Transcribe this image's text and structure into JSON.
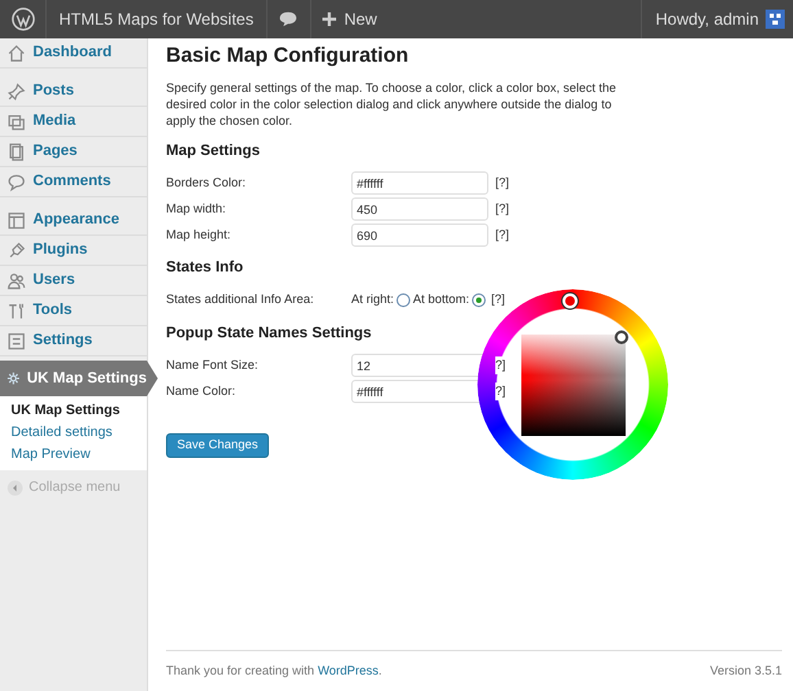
{
  "admin_bar": {
    "site_name": "HTML5 Maps for Websites",
    "new_label": "New",
    "greeting": "Howdy, admin"
  },
  "sidebar": {
    "items": [
      {
        "label": "Dashboard",
        "selected": false
      },
      {
        "label": "Posts",
        "selected": false
      },
      {
        "label": "Media",
        "selected": false
      },
      {
        "label": "Pages",
        "selected": false
      },
      {
        "label": "Comments",
        "selected": false
      },
      {
        "label": "Appearance",
        "selected": false
      },
      {
        "label": "Plugins",
        "selected": false
      },
      {
        "label": "Users",
        "selected": false
      },
      {
        "label": "Tools",
        "selected": false
      },
      {
        "label": "Settings",
        "selected": false
      },
      {
        "label": "UK Map Settings",
        "selected": true
      }
    ],
    "submenu": [
      {
        "label": "UK Map Settings",
        "selected": true
      },
      {
        "label": "Detailed settings",
        "selected": false
      },
      {
        "label": "Map Preview",
        "selected": false
      }
    ],
    "collapse_label": "Collapse menu"
  },
  "page": {
    "title": "Basic Map Configuration",
    "intro": "Specify general settings of the map. To choose a color, click a color box, select the desired color in the color selection dialog and click anywhere outside the dialog to apply the chosen color.",
    "sections": [
      {
        "heading": "Map Settings",
        "rows": [
          {
            "kind": "field",
            "label": "Borders Color:",
            "value": "#ffffff",
            "help": "[?]"
          },
          {
            "kind": "field",
            "label": "Map width:",
            "value": "450",
            "help": "[?]"
          },
          {
            "kind": "field",
            "label": "Map height:",
            "value": "690",
            "help": "[?]"
          }
        ]
      },
      {
        "heading": "States Info",
        "rows": [
          {
            "kind": "radio",
            "label": "States additional Info Area:",
            "options": [
              {
                "label": "At right:",
                "selected": false
              },
              {
                "label": "At bottom:",
                "selected": true
              }
            ],
            "help": "[?]"
          }
        ]
      },
      {
        "heading": "Popup State Names Settings",
        "rows": [
          {
            "kind": "field",
            "label": "Name Font Size:",
            "value": "12",
            "help": "?]"
          },
          {
            "kind": "field",
            "label": "Name Color:",
            "value": "#ffffff",
            "help": "?]"
          }
        ]
      }
    ],
    "save_button": "Save Changes"
  },
  "footer": {
    "thanks": "Thank you for creating with ",
    "link": "WordPress",
    "after": ".",
    "version": "Version 3.5.1"
  }
}
